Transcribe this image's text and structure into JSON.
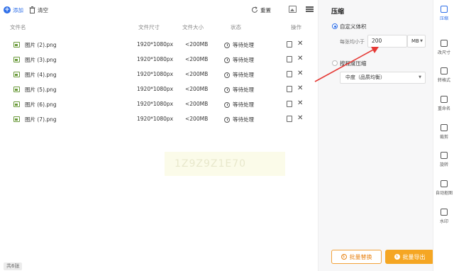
{
  "toolbar": {
    "add_label": "添加",
    "clear_label": "清空",
    "reset_label": "重置"
  },
  "table": {
    "headers": [
      "文件名",
      "文件尺寸",
      "文件大小",
      "状态",
      "操作"
    ],
    "rows": [
      {
        "name": "图片 (2).png",
        "dimensions": "1920*1080px",
        "size": "<200MB",
        "status": "等待处理"
      },
      {
        "name": "图片 (3).png",
        "dimensions": "1920*1080px",
        "size": "<200MB",
        "status": "等待处理"
      },
      {
        "name": "图片 (4).png",
        "dimensions": "1920*1080px",
        "size": "<200MB",
        "status": "等待处理"
      },
      {
        "name": "图片 (5).png",
        "dimensions": "1920*1080px",
        "size": "<200MB",
        "status": "等待处理"
      },
      {
        "name": "图片 (6).png",
        "dimensions": "1920*1080px",
        "size": "<200MB",
        "status": "等待处理"
      },
      {
        "name": "图片 (7).png",
        "dimensions": "1920*1080px",
        "size": "<200MB",
        "status": "等待处理"
      }
    ]
  },
  "watermark_text": "1Z9Z9Z1E70",
  "footer": {
    "count": "共6张"
  },
  "panel": {
    "title": "压缩",
    "option_custom": "自定义体积",
    "per_image_label": "每张均小于",
    "size_value": "200",
    "unit": "MB",
    "option_ratio": "按程度压缩",
    "quality": "中度（品质均衡）",
    "replace_label": "批量替换",
    "export_label": "批量导出",
    "accent_color": "#2f6fe8",
    "export_color": "#f5a623"
  },
  "sidebar": {
    "items": [
      {
        "label": "压缩",
        "icon": "compress-icon",
        "active": true
      },
      {
        "label": "改尺寸",
        "icon": "resize-icon",
        "active": false
      },
      {
        "label": "转格式",
        "icon": "convert-icon",
        "active": false
      },
      {
        "label": "重命名",
        "icon": "rename-icon",
        "active": false
      },
      {
        "label": "裁剪",
        "icon": "crop-icon",
        "active": false
      },
      {
        "label": "旋转",
        "icon": "rotate-icon",
        "active": false
      },
      {
        "label": "自动抠图",
        "icon": "cutout-icon",
        "active": false
      },
      {
        "label": "水印",
        "icon": "watermark-icon",
        "active": false
      }
    ]
  }
}
